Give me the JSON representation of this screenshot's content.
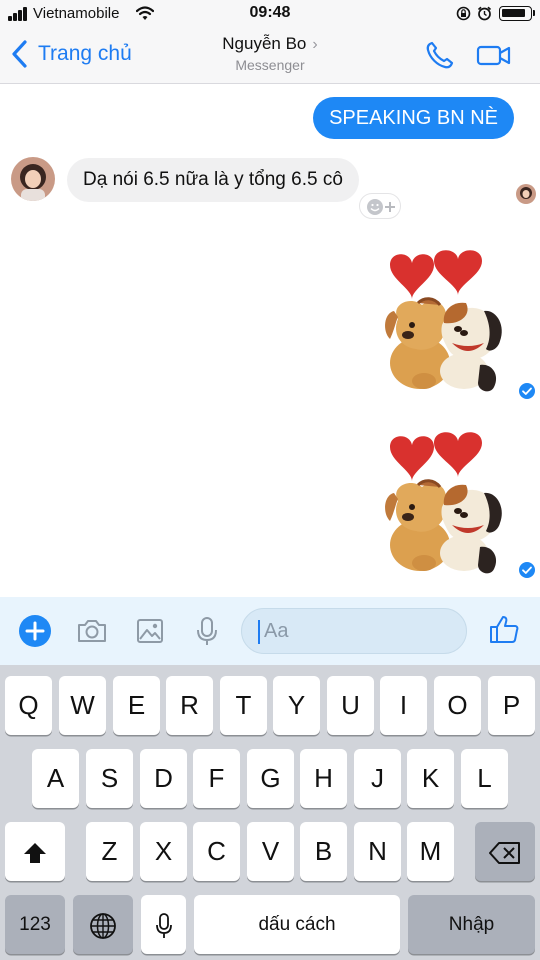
{
  "status_bar": {
    "carrier": "Vietnamobile",
    "time": "09:48",
    "battery_level_pct": 90
  },
  "header": {
    "back_label": "Trang chủ",
    "title": "Nguyễn Bo",
    "subtitle": "Messenger",
    "title_chevron": "›",
    "icons": [
      "back-chevron-icon",
      "phone-icon",
      "video-camera-icon",
      "chevron-right-icon"
    ]
  },
  "chat": {
    "messages": [
      {
        "direction": "outgoing",
        "type": "text",
        "text": "SPEAKING BN NÈ"
      },
      {
        "direction": "incoming",
        "type": "text",
        "text": "Dạ nói 6.5 nữa là y tổng 6.5 cô"
      },
      {
        "direction": "outgoing",
        "type": "sticker",
        "sticker": "dogs-hugging-hearts"
      },
      {
        "direction": "outgoing",
        "type": "sticker",
        "sticker": "dogs-hugging-hearts"
      }
    ],
    "colors": {
      "outgoing_bubble": "#1e88f5",
      "incoming_bubble": "#f0f0f1",
      "accent": "#1e7cf2"
    }
  },
  "composer": {
    "placeholder": "Aa",
    "icons": [
      "plus-icon",
      "camera-icon",
      "image-icon",
      "microphone-icon",
      "emoji-icon",
      "thumbs-up-icon"
    ]
  },
  "keyboard": {
    "row1": [
      "Q",
      "W",
      "E",
      "R",
      "T",
      "Y",
      "U",
      "I",
      "O",
      "P"
    ],
    "row2": [
      "A",
      "S",
      "D",
      "F",
      "G",
      "H",
      "J",
      "K",
      "L"
    ],
    "row3": [
      "Z",
      "X",
      "C",
      "V",
      "B",
      "N",
      "M"
    ],
    "numbers_label": "123",
    "space_label": "dấu cách",
    "return_label": "Nhập"
  }
}
